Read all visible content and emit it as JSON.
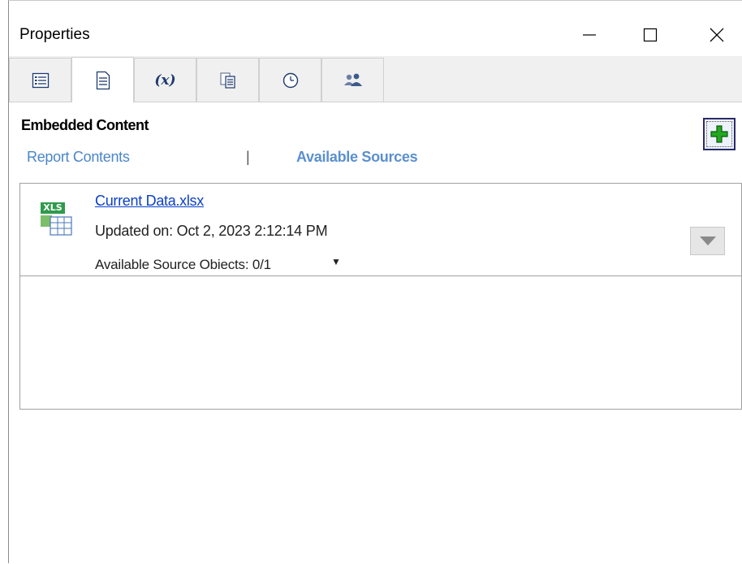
{
  "window": {
    "title": "Properties",
    "minimize_icon": "minimize-icon",
    "maximize_icon": "maximize-icon",
    "close_icon": "close-icon"
  },
  "tabs": [
    {
      "id": "list",
      "icon": "list-icon",
      "label": ""
    },
    {
      "id": "document",
      "icon": "document-icon",
      "label": "",
      "active": true
    },
    {
      "id": "variables",
      "icon": "function-icon",
      "label": "(x)"
    },
    {
      "id": "pages",
      "icon": "pages-icon",
      "label": ""
    },
    {
      "id": "schedule",
      "icon": "clock-icon",
      "label": ""
    },
    {
      "id": "users",
      "icon": "users-icon",
      "label": ""
    }
  ],
  "section": {
    "title": "Embedded Content",
    "report_contents_label": "Report Contents",
    "separator": "|",
    "available_sources_label": "Available Sources",
    "add_button_icon": "plus-icon"
  },
  "source": {
    "icon_tag": "XLS",
    "file_name": "Current Data.xlsx",
    "updated": "Updated on: Oct 2, 2023 2:12:14 PM",
    "available_objects": "Available Source Obiects:  0/1",
    "caret": "▼"
  },
  "colors": {
    "link": "#0b40c8",
    "sub_link": "#4a86c8",
    "xls_green": "#2f9a4c",
    "add_green": "#23a723"
  }
}
